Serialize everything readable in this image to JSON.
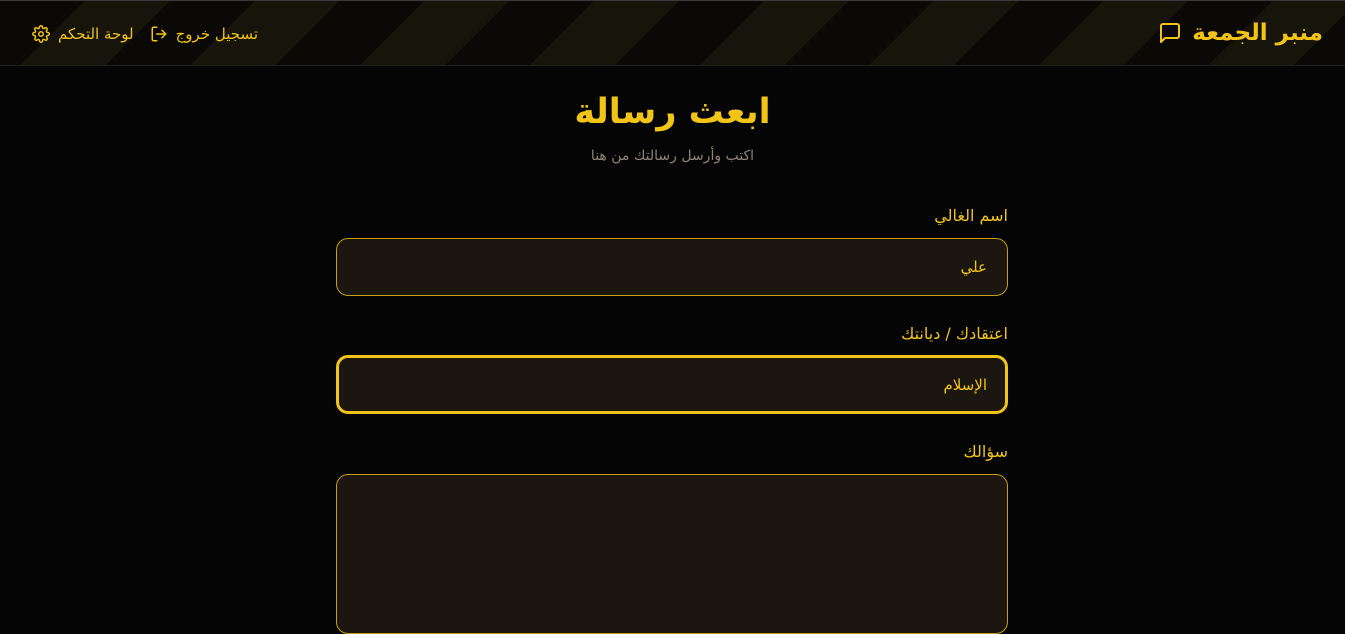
{
  "header": {
    "brand": "منبر الجمعة",
    "nav": {
      "logout_label": "تسجيل خروج",
      "dashboard_label": "لوحة التحكم"
    }
  },
  "page": {
    "title": "ابعث رسالة",
    "subtitle": "اكتب وأرسل رسالتك من هنا"
  },
  "form": {
    "name": {
      "label": "اسم الغالي",
      "value": "علي"
    },
    "belief": {
      "label": "اعتقادك / ديانتك",
      "value": "الإسلام"
    },
    "question": {
      "label": "سؤالك",
      "value": ""
    }
  },
  "colors": {
    "accent": "#f2c417",
    "background": "#050505",
    "field_bg": "#1c1611",
    "muted": "#8c8275"
  },
  "icons": {
    "brand": "message-square-icon",
    "logout": "log-out-icon",
    "dashboard": "gear-icon"
  }
}
